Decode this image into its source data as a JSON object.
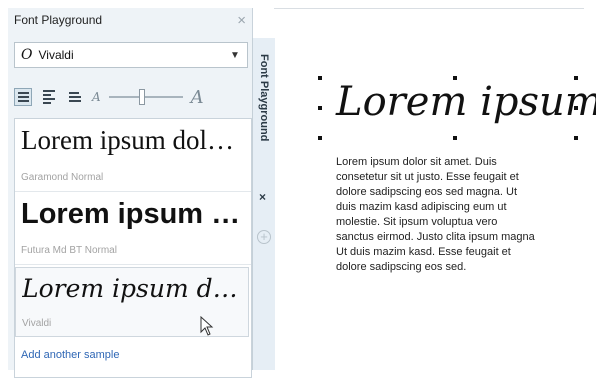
{
  "panel": {
    "title": "Font Playground",
    "close_glyph": "×",
    "font_selector": {
      "value": "Vivaldi",
      "icon": "o-font-icon",
      "chevron": "chevron-down-icon"
    },
    "toolbar": {
      "view_buttons": [
        "list-view-icon",
        "paragraph-view-icon",
        "single-line-view-icon"
      ],
      "zoom_small_glyph": "A",
      "zoom_big_glyph": "A",
      "zoom_level": 0.45
    },
    "samples": [
      {
        "preview": "Lorem ipsum dolor sit amet",
        "font_name": "Garamond Normal"
      },
      {
        "preview": "Lorem ipsum dolor sit amet",
        "font_name": "Futura Md BT Normal"
      },
      {
        "preview": "Lorem ipsum dolor sit amet",
        "font_name": "Vivaldi"
      }
    ],
    "add_sample_link": "Add another sample"
  },
  "side_tab": {
    "label": "Font Playground",
    "close_glyph": "×",
    "add_glyph": "+"
  },
  "canvas": {
    "title": "Lorem ipsum",
    "paragraph": "Lorem ipsum dolor sit amet. Duis consetetur sit ut justo. Esse feugait et dolore sadipscing eos sed magna. Ut duis mazim kasd adipiscing eum ut molestie. Sit ipsum voluptua vero sanctus eirmod. Justo clita ipsum magna Ut duis mazim kasd. Esse feugait et dolore sadipscing eos sed."
  }
}
